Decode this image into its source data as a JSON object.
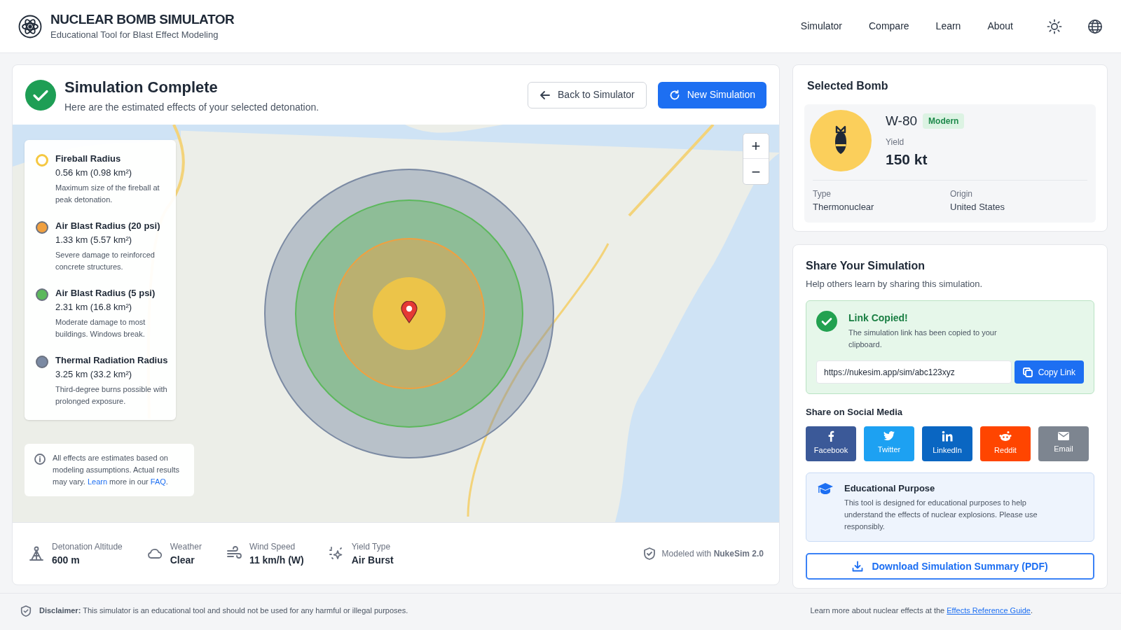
{
  "header": {
    "title": "NUCLEAR BOMB SIMULATOR",
    "subtitle": "Educational Tool for Blast Effect Modeling",
    "nav": [
      "Simulator",
      "Compare",
      "Learn",
      "About"
    ]
  },
  "result": {
    "title": "Simulation Complete",
    "subtitle": "Here are the estimated effects of your selected detonation.",
    "back_button": "Back to Simulator",
    "new_button": "New Simulation"
  },
  "map": {
    "zoom_in": "+",
    "zoom_out": "−",
    "legend": [
      {
        "name": "Fireball Radius",
        "value": "0.56 km (0.98 km²)",
        "description": "Maximum size of the fireball at peak detonation.",
        "color": "#f5c842"
      },
      {
        "name": "Air Blast Radius (20 psi)",
        "value": "1.33 km (5.57 km²)",
        "description": "Severe damage to reinforced concrete structures.",
        "color": "#f0a040"
      },
      {
        "name": "Air Blast Radius (5 psi)",
        "value": "2.31 km (16.8 km²)",
        "description": "Moderate damage to most buildings. Windows break.",
        "color": "#5cb85c"
      },
      {
        "name": "Thermal Radiation Radius",
        "value": "3.25 km (33.2 km²)",
        "description": "Third-degree burns possible with prolonged exposure.",
        "color": "#7b8aa3"
      }
    ],
    "note": [
      {
        "kind": "text",
        "text": "All effects are estimates based on modeling assumptions. Actual results may vary. "
      },
      {
        "kind": "link",
        "text": "Learn"
      },
      {
        "kind": "text",
        "text": " more in our "
      },
      {
        "kind": "link",
        "text": "FAQ"
      },
      {
        "kind": "text",
        "text": "."
      }
    ]
  },
  "stats": [
    {
      "label": "Detonation Altitude",
      "value": "600 m"
    },
    {
      "label": "Weather",
      "value": "Clear"
    },
    {
      "label": "Wind Speed",
      "value": "11 km/h (W)"
    },
    {
      "label": "Yield Type",
      "value": "Air Burst"
    }
  ],
  "model_note": "Modeled with **NukeSim 2.0**",
  "bomb": {
    "heading": "Selected Bomb",
    "name": "W-80",
    "tag": "Modern",
    "yield_label": "Yield",
    "yield": "150 kt",
    "type_label": "Type",
    "type": "Thermonuclear",
    "origin_label": "Origin",
    "origin": "United States"
  },
  "share": {
    "heading": "Share Your Simulation",
    "subtitle": "Help others learn by sharing this simulation.",
    "copied_title": "Link Copied!",
    "copied_text": "The simulation link has been copied to your clipboard.",
    "url": "https://nukesim.app/sim/abc123xyz",
    "copy_button": "Copy Link",
    "social_heading": "Share on Social Media",
    "social": [
      {
        "label": "Facebook",
        "color": "#3b5998"
      },
      {
        "label": "Twitter",
        "color": "#1da1f2"
      },
      {
        "label": "LinkedIn",
        "color": "#0a66c2"
      },
      {
        "label": "Reddit",
        "color": "#ff4500"
      },
      {
        "label": "Email",
        "color": "#7d8590"
      }
    ],
    "edu_title": "Educational Purpose",
    "edu_text": "This tool is designed for educational purposes to help understand the effects of nuclear explosions. Please use responsibly.",
    "download_button": "Download Simulation Summary (PDF)"
  },
  "footer": {
    "disclaimer": "**Disclaimer:** This simulator is an educational tool and should not be used for any harmful or illegal purposes.",
    "guide_prefix": "Learn more about nuclear effects at the ",
    "guide_link": "Effects Reference Guide",
    "guide_suffix": "."
  }
}
